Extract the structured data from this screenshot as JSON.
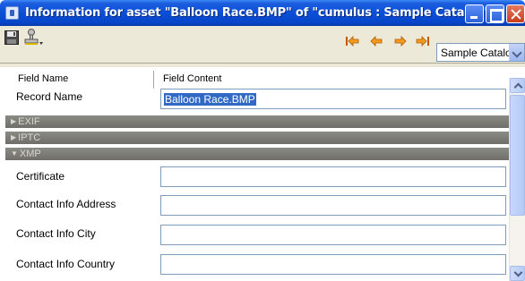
{
  "window": {
    "title": "Information for asset \"Balloon Race.BMP\" of \"cumulus : Sample Catalog\""
  },
  "toolbar": {
    "catalog_selected": "Sample Catalog"
  },
  "columns": {
    "name": "Field Name",
    "content": "Field Content"
  },
  "record": {
    "label": "Record Name",
    "value": "Balloon Race.BMP"
  },
  "sections": [
    {
      "label": "EXIF",
      "expanded": false
    },
    {
      "label": "IPTC",
      "expanded": false
    },
    {
      "label": "XMP",
      "expanded": true
    }
  ],
  "xmp_fields": [
    {
      "label": "Certificate",
      "value": ""
    },
    {
      "label": "Contact Info Address",
      "value": ""
    },
    {
      "label": "Contact Info City",
      "value": ""
    },
    {
      "label": "Contact Info Country",
      "value": ""
    }
  ],
  "icons": {
    "collapsed": "▶",
    "expanded": "▼"
  }
}
